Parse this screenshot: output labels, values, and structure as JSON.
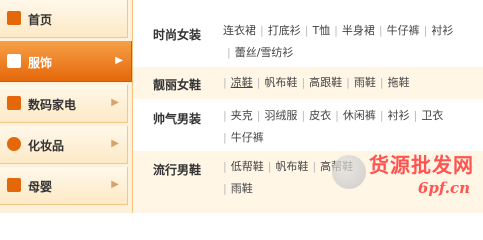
{
  "sidebar": {
    "items": [
      {
        "label": "首页",
        "icon": "home-icon",
        "color": "#e4680a"
      },
      {
        "label": "服饰",
        "icon": "clothing-icon",
        "color": "#ffffff",
        "active": true
      },
      {
        "label": "数码家电",
        "icon": "laptop-icon",
        "color": "#e4680a"
      },
      {
        "label": "化妆品",
        "icon": "cosmetics-icon",
        "color": "#e4680a"
      },
      {
        "label": "母婴",
        "icon": "baby-icon",
        "color": "#e4680a"
      }
    ]
  },
  "sections": [
    {
      "title": "时尚女装",
      "links": [
        "连衣裙",
        "打底衫",
        "T恤",
        "半身裙",
        "牛仔裤",
        "衬衫",
        "蕾丝/雪纺衫"
      ]
    },
    {
      "title": "靓丽女鞋",
      "links": [
        "凉鞋",
        "帆布鞋",
        "高跟鞋",
        "雨鞋",
        "拖鞋"
      ]
    },
    {
      "title": "帅气男装",
      "links": [
        "夹克",
        "羽绒服",
        "皮衣",
        "休闲裤",
        "衬衫",
        "卫衣",
        "牛仔裤"
      ]
    },
    {
      "title": "流行男鞋",
      "links": [
        "低帮鞋",
        "帆布鞋",
        "高帮鞋",
        "雨鞋"
      ]
    }
  ],
  "watermark": {
    "cn": "货源批发网",
    "url": "6pf.cn"
  }
}
